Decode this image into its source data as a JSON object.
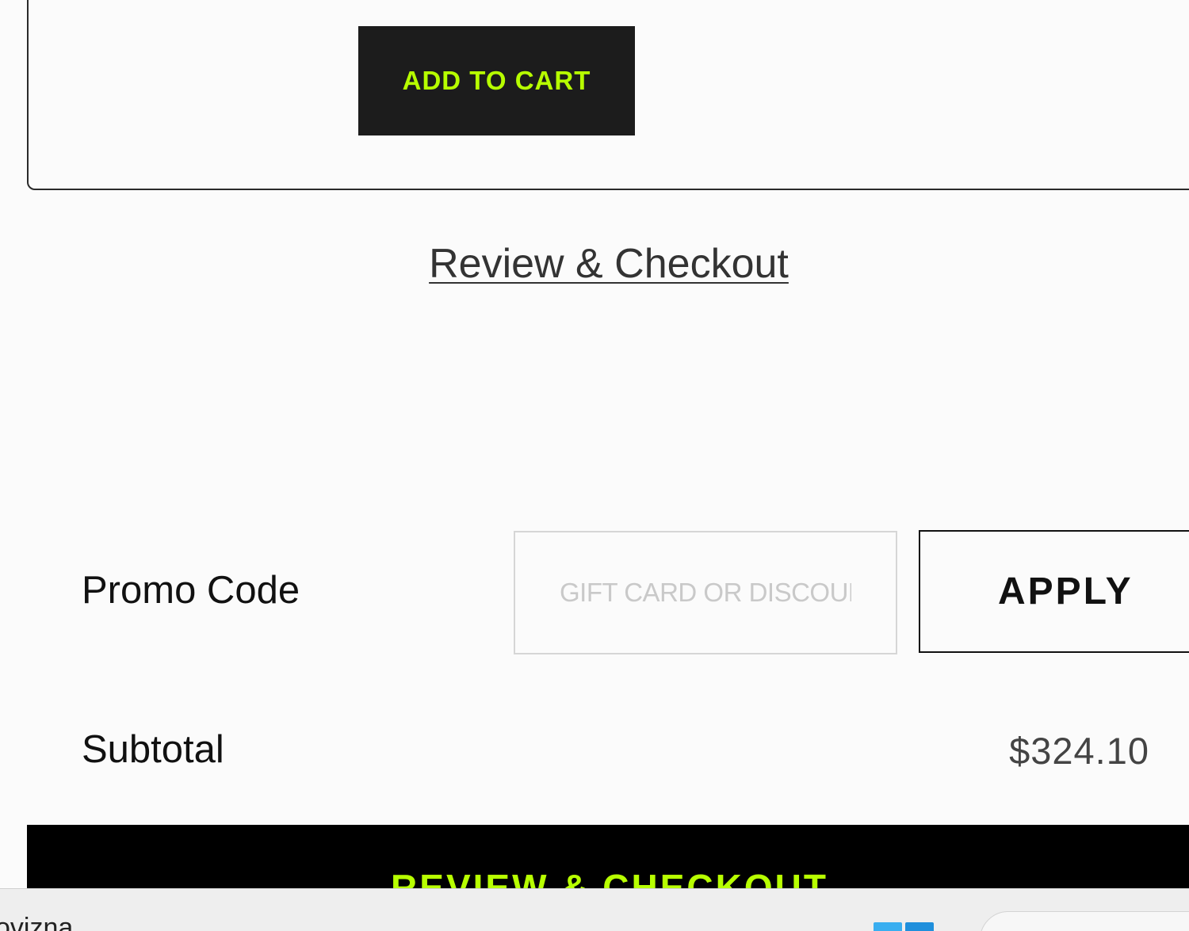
{
  "product_card": {
    "add_to_cart_label": "ADD TO CART"
  },
  "review_link_label": "Review & Checkout",
  "promo": {
    "label": "Promo Code",
    "placeholder": "GIFT CARD OR DISCOUNT CODE",
    "value": "",
    "apply_label": "APPLY"
  },
  "subtotal": {
    "label": "Subtotal",
    "value": "$324.10"
  },
  "checkout_bar_label": "REVIEW & CHECKOUT",
  "taskbar": {
    "partial_text": "ovizna",
    "start_icon": "windows-start-icon",
    "search_icon": "taskbar-search-box"
  },
  "colors": {
    "accent": "#b7ff00",
    "button_dark": "#1c1c1c",
    "bar_black": "#000000",
    "background": "#fbfbfb"
  }
}
